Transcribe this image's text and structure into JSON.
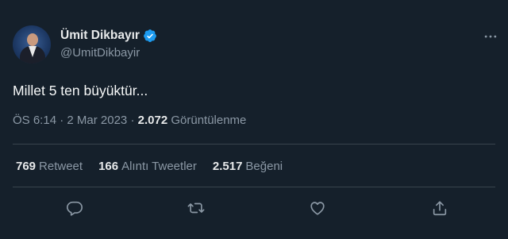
{
  "theme": {
    "background": "#15202b",
    "text_primary": "#e7e9ea",
    "text_secondary": "#8b98a5",
    "divider": "#38444d",
    "verified_blue": "#1d9bf0"
  },
  "author": {
    "display_name": "Ümit Dikbayır",
    "handle": "@UmitDikbayir",
    "verified": true
  },
  "tweet": {
    "text": "Millet 5 ten büyüktür..."
  },
  "meta": {
    "time": "ÖS 6:14",
    "separator1": " · ",
    "date": "2 Mar 2023",
    "separator2": " · ",
    "views_count": "2.072",
    "views_label": "Görüntülenme"
  },
  "stats": {
    "retweets": {
      "count": "769",
      "label": "Retweet"
    },
    "quotes": {
      "count": "166",
      "label": "Alıntı Tweetler"
    },
    "likes": {
      "count": "2.517",
      "label": "Beğeni"
    }
  },
  "icons": {
    "more": "more-icon",
    "reply": "reply-icon",
    "retweet": "retweet-icon",
    "like": "like-icon",
    "share": "share-icon"
  }
}
